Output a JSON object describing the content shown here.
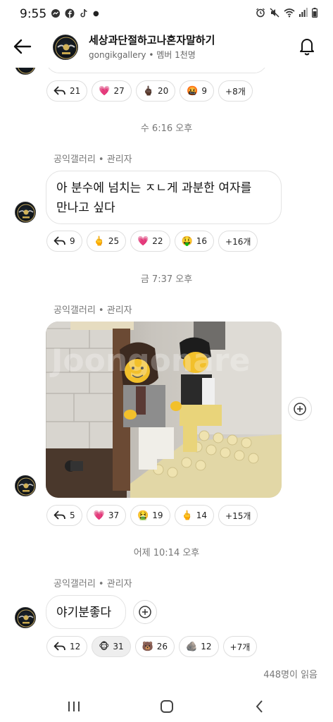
{
  "status_bar": {
    "time": "9:55",
    "left_icons": [
      "messenger-icon",
      "facebook-icon",
      "tiktok-icon",
      "dot-icon"
    ],
    "right_icons": [
      "alarm-icon",
      "mute-icon",
      "wifi-icon",
      "signal-icon",
      "battery-icon"
    ]
  },
  "header": {
    "title": "세상과단절하고나혼자말하기",
    "subtitle": "gongikgallery • 멤버 1천명"
  },
  "messages": [
    {
      "reactions": [
        {
          "icon": "reply-icon",
          "count": "21"
        },
        {
          "icon": "heart-icon",
          "emoji": "💗",
          "count": "27"
        },
        {
          "icon": "middle-finger-icon",
          "emoji": "🖕🏿",
          "count": "20"
        },
        {
          "icon": "angry-face-icon",
          "emoji": "🤬",
          "count": "9"
        },
        {
          "icon": "more",
          "count": "+8개"
        }
      ]
    },
    {
      "date": "수 6:16 오후",
      "sender": "공익갤러리 • 관리자",
      "text_line1": "아 분수에 넘치는 ㅈㄴ게 과분한 여자를",
      "text_line2": "만나고 싶다",
      "reactions": [
        {
          "icon": "reply-icon",
          "count": "9"
        },
        {
          "icon": "middle-finger-icon",
          "emoji": "🖕",
          "count": "25"
        },
        {
          "icon": "heart-icon",
          "emoji": "💗",
          "count": "22"
        },
        {
          "icon": "money-face-icon",
          "emoji": "🤑",
          "count": "16"
        },
        {
          "icon": "more",
          "count": "+16개"
        }
      ]
    },
    {
      "date": "금 7:37 오후",
      "sender": "공익갤러리 • 관리자",
      "image_watermark": "Joongonare",
      "reactions": [
        {
          "icon": "reply-icon",
          "count": "5"
        },
        {
          "icon": "heart-icon",
          "emoji": "💗",
          "count": "37"
        },
        {
          "icon": "nauseated-face-icon",
          "emoji": "🤮",
          "count": "19"
        },
        {
          "icon": "middle-finger-icon",
          "emoji": "🖕",
          "count": "14"
        },
        {
          "icon": "more",
          "count": "+15개"
        }
      ]
    },
    {
      "date": "어제 10:14 오후",
      "sender": "공익갤러리 • 관리자",
      "text": "야기분좋다",
      "reactions": [
        {
          "icon": "reply-icon",
          "count": "12"
        },
        {
          "icon": "monkey-icon",
          "emoji": "🐵",
          "count": "31",
          "selected": true
        },
        {
          "icon": "bear-icon",
          "emoji": "🐻",
          "count": "26"
        },
        {
          "icon": "rock-icon",
          "emoji": "🪨",
          "count": "12"
        },
        {
          "icon": "more",
          "count": "+7개"
        }
      ]
    }
  ],
  "read_count": "448명이 읽음"
}
